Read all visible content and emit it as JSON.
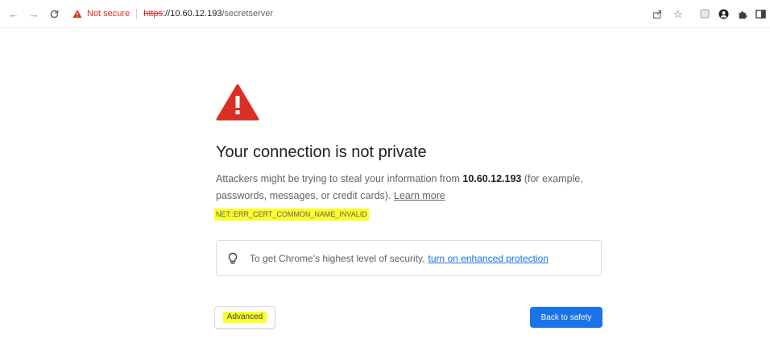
{
  "toolbar": {
    "back_icon": "arrow-left-icon",
    "forward_icon": "arrow-right-icon",
    "reload_icon": "reload-icon",
    "security_label": "Not secure",
    "url": {
      "scheme": "https",
      "host": "://10.60.12.193",
      "path": "/secretserver"
    },
    "right_icons": [
      "share-icon",
      "star-icon",
      "extension-square-icon",
      "account-icon",
      "puzzle-icon",
      "sidebar-icon"
    ]
  },
  "interstitial": {
    "heading": "Your connection is not private",
    "description_prefix": "Attackers might be trying to steal your information from ",
    "host": "10.60.12.193",
    "description_suffix": " (for example, passwords, messages, or credit cards). ",
    "learn_more": "Learn more",
    "error_code": "NET::ERR_CERT_COMMON_NAME_INVALID",
    "enhanced_text": "To get Chrome's highest level of security,",
    "enhanced_link": "turn on enhanced protection",
    "advanced_label": "Advanced",
    "back_to_safety_label": "Back to safety"
  },
  "colors": {
    "warning_red": "#d93025",
    "link_blue": "#1a73e8",
    "primary_button": "#1a73e8",
    "highlight_yellow": "#fbff2a"
  }
}
